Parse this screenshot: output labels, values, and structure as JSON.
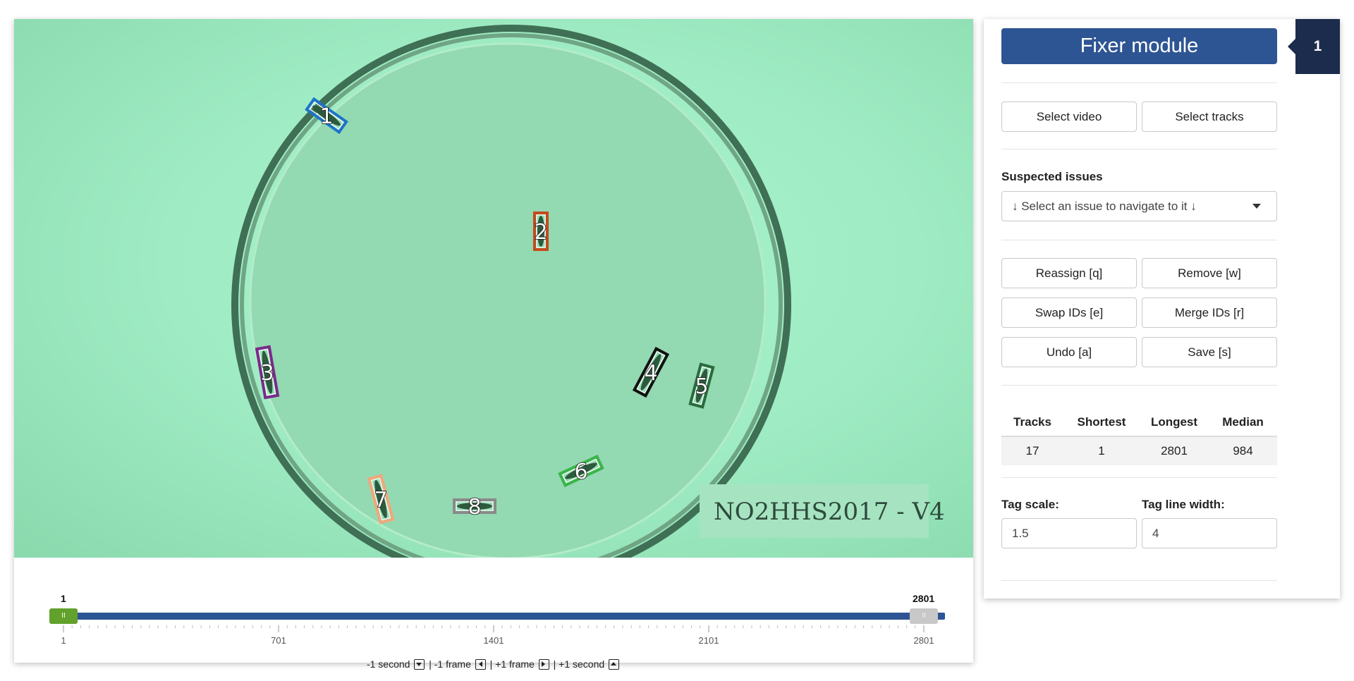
{
  "video": {
    "plate_label": "NO2HHS2017 - V4",
    "tags": [
      {
        "id": "1",
        "color": "#1e74c9"
      },
      {
        "id": "2",
        "color": "#c44a1c"
      },
      {
        "id": "3",
        "color": "#7a2a8a"
      },
      {
        "id": "4",
        "color": "#111111"
      },
      {
        "id": "5",
        "color": "#2a6b3e"
      },
      {
        "id": "6",
        "color": "#3ab54a"
      },
      {
        "id": "7",
        "color": "#f0a87a"
      },
      {
        "id": "8",
        "color": "#8a8a8a"
      }
    ]
  },
  "slider": {
    "min_label": "1",
    "max_label": "2801",
    "handle_left_glyph": "II",
    "handle_right_glyph": "II",
    "ticks": [
      "1",
      "701",
      "1401",
      "2101",
      "2801"
    ],
    "nav": {
      "back_second": "-1 second",
      "back_frame": "-1 frame",
      "fwd_frame": "+1 frame",
      "fwd_second": "+1 second",
      "sep": "|"
    }
  },
  "panel": {
    "title": "Fixer module",
    "badge": "1",
    "select_video": "Select video",
    "select_tracks": "Select tracks",
    "issues_label": "Suspected issues",
    "issues_placeholder": "↓ Select an issue to navigate to it ↓",
    "reassign": "Reassign [q]",
    "remove": "Remove [w]",
    "swap": "Swap IDs [e]",
    "merge": "Merge IDs [r]",
    "undo": "Undo [a]",
    "save": "Save [s]",
    "stats": {
      "headers": [
        "Tracks",
        "Shortest",
        "Longest",
        "Median"
      ],
      "values": [
        "17",
        "1",
        "2801",
        "984"
      ]
    },
    "tag_scale_label": "Tag scale:",
    "tag_scale_value": "1.5",
    "tag_line_width_label": "Tag line width:",
    "tag_line_width_value": "4"
  },
  "colors": {
    "primary": "#2e5593",
    "badge": "#1c2c4c",
    "handle_start": "#62a12c"
  }
}
